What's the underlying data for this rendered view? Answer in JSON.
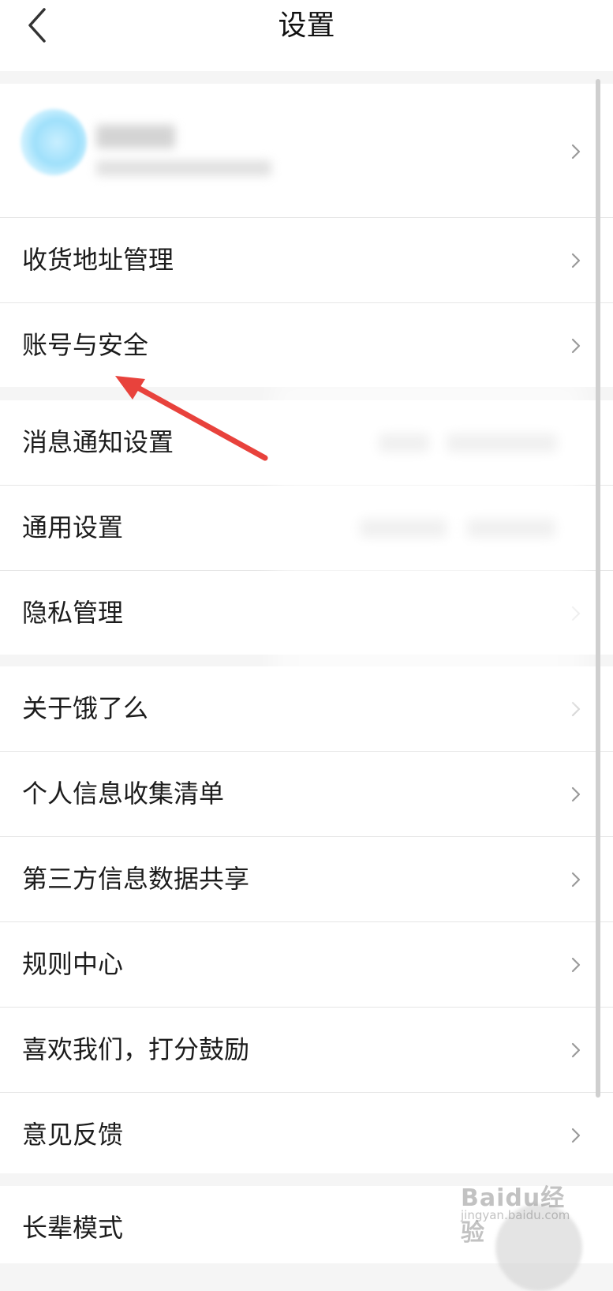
{
  "header": {
    "title": "设置",
    "back_icon": "chevron-left-icon"
  },
  "groups": [
    {
      "rows": [
        {
          "label": "收货地址管理"
        },
        {
          "label": "账号与安全"
        }
      ]
    },
    {
      "rows": [
        {
          "label": "消息通知设置"
        },
        {
          "label": "通用设置"
        },
        {
          "label": "隐私管理"
        }
      ]
    },
    {
      "rows": [
        {
          "label": "关于饿了么"
        },
        {
          "label": "个人信息收集清单"
        },
        {
          "label": "第三方信息数据共享"
        },
        {
          "label": "规则中心"
        },
        {
          "label": "喜欢我们，打分鼓励"
        },
        {
          "label": "意见反馈"
        }
      ]
    },
    {
      "rows": [
        {
          "label": "长辈模式"
        }
      ]
    }
  ],
  "watermark": {
    "logo": "Baidu经验",
    "sub": "jingyan.baidu.com"
  },
  "colors": {
    "annotation_arrow": "#e8423c",
    "background": "#f5f5f5",
    "row_background": "#ffffff",
    "divider": "#e6e6e6"
  }
}
